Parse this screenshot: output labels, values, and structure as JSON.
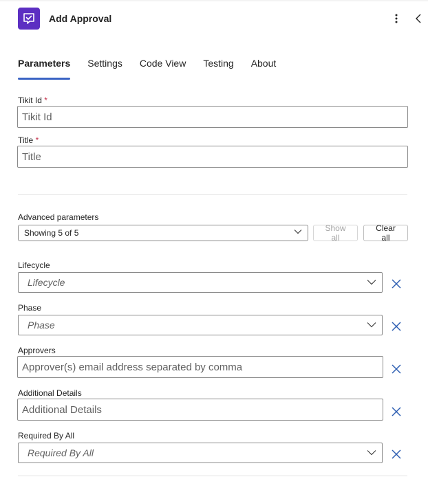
{
  "header": {
    "title": "Add Approval",
    "accent_color": "#5c2fc2",
    "icon": "approval-check-icon",
    "more_icon": "more-vertical-icon",
    "collapse_icon": "chevron-left-icon"
  },
  "tabs": [
    {
      "label": "Parameters",
      "active": true
    },
    {
      "label": "Settings",
      "active": false
    },
    {
      "label": "Code View",
      "active": false
    },
    {
      "label": "Testing",
      "active": false
    },
    {
      "label": "About",
      "active": false
    }
  ],
  "required_fields": {
    "tikit_id": {
      "label": "Tikit Id",
      "required_mark": "*",
      "placeholder": "Tikit Id",
      "value": ""
    },
    "title": {
      "label": "Title",
      "required_mark": "*",
      "placeholder": "Title",
      "value": ""
    }
  },
  "advanced": {
    "label": "Advanced parameters",
    "selected": "Showing 5 of 5",
    "show_all_label": "Show all",
    "clear_all_label": "Clear all"
  },
  "params": {
    "lifecycle": {
      "label": "Lifecycle",
      "placeholder": "Lifecycle"
    },
    "phase": {
      "label": "Phase",
      "placeholder": "Phase"
    },
    "approvers": {
      "label": "Approvers",
      "placeholder": "Approver(s) email address separated by comma"
    },
    "additional_details": {
      "label": "Additional Details",
      "placeholder": "Additional Details"
    },
    "required_by_all": {
      "label": "Required By All",
      "placeholder": "Required By All"
    }
  }
}
